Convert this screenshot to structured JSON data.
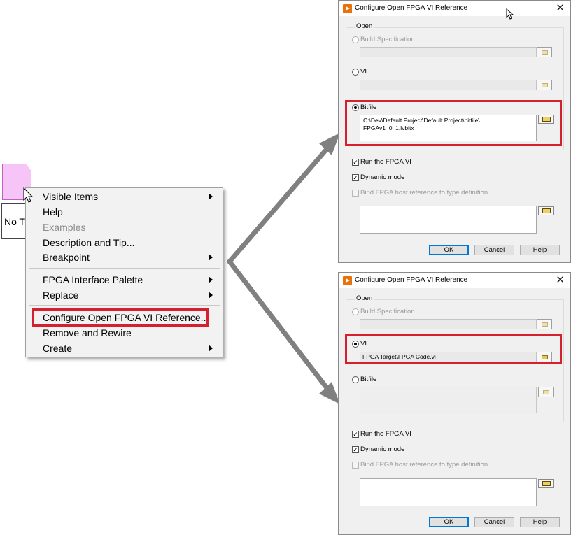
{
  "node": {
    "label": "No T"
  },
  "context_menu": {
    "items": [
      {
        "label": "Visible Items",
        "submenu": true,
        "disabled": false
      },
      {
        "label": "Help",
        "submenu": false,
        "disabled": false
      },
      {
        "label": "Examples",
        "submenu": false,
        "disabled": true
      },
      {
        "label": "Description and Tip...",
        "submenu": false,
        "disabled": false
      },
      {
        "label": "Breakpoint",
        "submenu": true,
        "disabled": false
      },
      {
        "label": "FPGA Interface Palette",
        "submenu": true,
        "disabled": false
      },
      {
        "label": "Replace",
        "submenu": true,
        "disabled": false
      },
      {
        "label": "Configure Open FPGA VI Reference...",
        "submenu": false,
        "disabled": false,
        "highlighted": true
      },
      {
        "label": "Remove and Rewire",
        "submenu": false,
        "disabled": false
      },
      {
        "label": "Create",
        "submenu": true,
        "disabled": false
      }
    ]
  },
  "dialog_top": {
    "title": "Configure Open FPGA VI Reference",
    "close": "✕",
    "group_label": "Open",
    "build_spec_label": "Build Specification",
    "vi_label": "VI",
    "bitfile_label": "Bitfile",
    "bitfile_path_line1": "C:\\Dev\\Default Project\\Default Project\\bitfile\\",
    "bitfile_path_line2": "FPGAv1_0_1.lvbitx",
    "selected": "Bitfile",
    "run_label": "Run the FPGA VI",
    "run_checked": true,
    "dynamic_label": "Dynamic mode",
    "dynamic_checked": true,
    "bind_label": "Bind FPGA host reference to type definition",
    "bind_checked": false,
    "ok": "OK",
    "cancel": "Cancel",
    "help": "Help"
  },
  "dialog_bottom": {
    "title": "Configure Open FPGA VI Reference",
    "close": "✕",
    "group_label": "Open",
    "build_spec_label": "Build Specification",
    "vi_label": "VI",
    "vi_path": "FPGA Target\\FPGA Code.vi",
    "bitfile_label": "Bitfile",
    "selected": "VI",
    "run_label": "Run the FPGA VI",
    "run_checked": true,
    "dynamic_label": "Dynamic mode",
    "dynamic_checked": true,
    "bind_label": "Bind FPGA host reference to type definition",
    "bind_checked": false,
    "ok": "OK",
    "cancel": "Cancel",
    "help": "Help"
  },
  "colors": {
    "highlight_red": "#d6202e",
    "arrow_gray": "#808080",
    "node_pink": "#f6c4f6",
    "labview_orange": "#e8720c"
  },
  "icons": {
    "cursor": "arrow-pointer-icon",
    "folder": "folder-icon",
    "submenu": "chevron-right-icon",
    "app": "labview-icon"
  }
}
